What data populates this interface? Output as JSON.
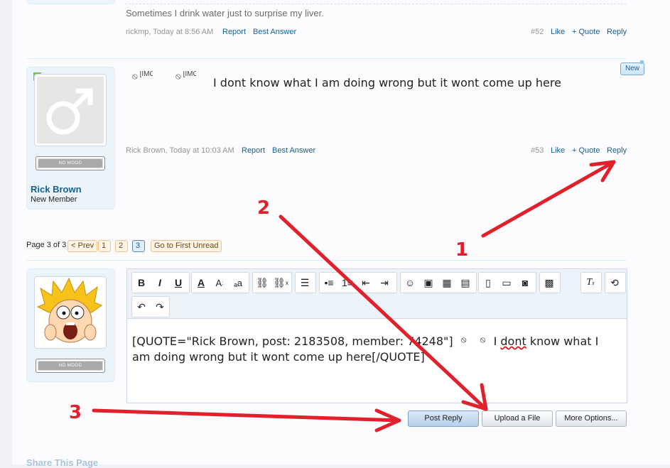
{
  "post52": {
    "message": "Sometimes I drink water just to surprise my liver.",
    "author_time": "rickmp, Today at 8:56 AM",
    "report": "Report",
    "best_answer": "Best Answer",
    "post_num": "#52",
    "like": "Like",
    "quote": "+ Quote",
    "reply": "Reply"
  },
  "post53": {
    "badge": "New",
    "broken_img_1": "[IMG]",
    "broken_img_2": "[IMG]",
    "message": "I dont know what I am doing wrong but it wont come up here",
    "author_time": "Rick Brown, Today at 10:03 AM",
    "report": "Report",
    "best_answer": "Best Answer",
    "post_num": "#53",
    "like": "Like",
    "quote": "+ Quote",
    "reply": "Reply",
    "username": "Rick Brown",
    "user_title": "New Member",
    "mood": "NO MOOD"
  },
  "pagination": {
    "page_of": "Page 3 of 3",
    "prev": "< Prev",
    "pages": [
      "1",
      "2",
      "3"
    ],
    "first_unread": "Go to First Unread"
  },
  "reply_box": {
    "mood": "NO MOOD",
    "editor_text_1": "[QUOTE=\"Rick Brown, post: 2183508, member: 74248\"]",
    "editor_dont": "dont",
    "editor_text_2": "I",
    "editor_text_3": "know what I",
    "editor_text_4": "am doing wrong but it wont come up here[/QUOTE]",
    "post_reply": "Post Reply",
    "upload_file": "Upload a File",
    "more_options": "More Options..."
  },
  "annotations": {
    "label_1": "1",
    "label_2": "2",
    "label_3": "3",
    "arrow_color": "#e0202a"
  },
  "footer": {
    "share": "Share This Page"
  }
}
